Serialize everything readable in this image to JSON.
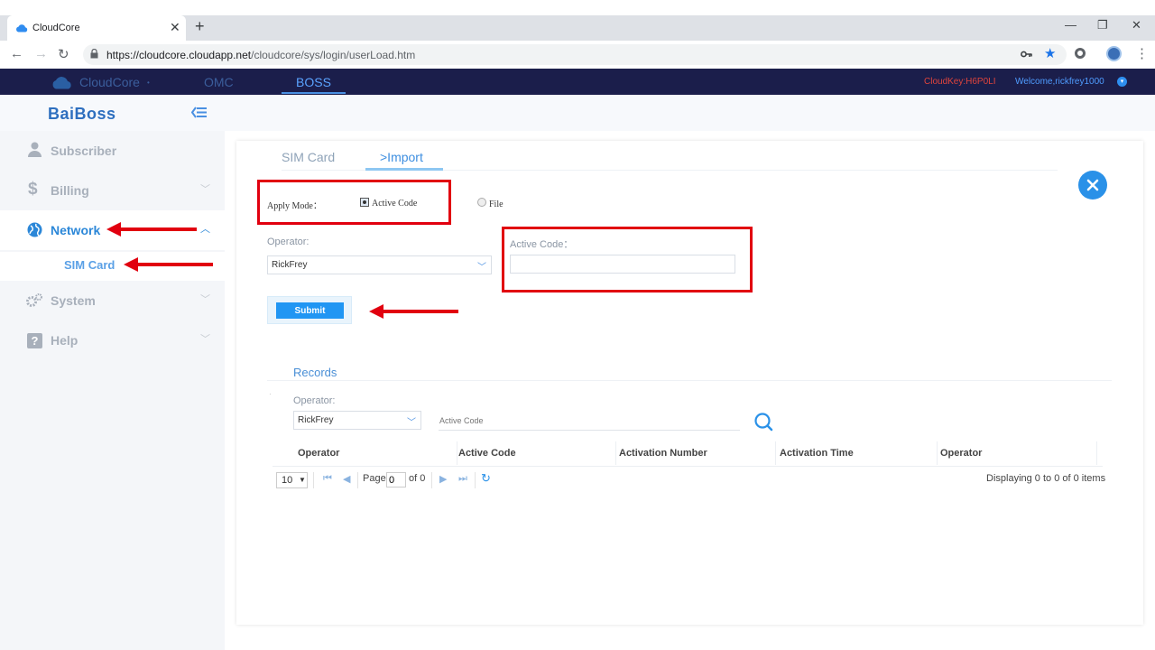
{
  "browser": {
    "tab_title": "CloudCore",
    "tab_close": "✕",
    "new_tab": "+",
    "minimize": "—",
    "maximize": "❐",
    "close_window": "✕",
    "url_host": "https://cloudcore.cloudapp.net",
    "url_path": "/cloudcore/sys/login/userLoad.htm"
  },
  "topnav": {
    "brand": "CloudCore",
    "items": [
      "OMC",
      "BOSS"
    ],
    "active_item": "BOSS",
    "cloud_key": "CloudKey:H6P0LI",
    "welcome": "Welcome,rickfrey1000"
  },
  "header": {
    "logo": "BaiBoss"
  },
  "sidebar": {
    "items": [
      {
        "label": "Subscriber",
        "icon": "user-icon",
        "chevron": ""
      },
      {
        "label": "Billing",
        "icon": "dollar-icon",
        "chevron": "﹀"
      },
      {
        "label": "Network",
        "icon": "globe-icon",
        "chevron": "︿"
      },
      {
        "label": "System",
        "icon": "gears-icon",
        "chevron": "﹀"
      },
      {
        "label": "Help",
        "icon": "help-icon",
        "chevron": "﹀"
      }
    ],
    "sub_item": "SIM Card"
  },
  "main": {
    "tabs": [
      "SIM Card",
      ">Import"
    ],
    "apply_mode_label": "Apply Mode：",
    "mode_options": [
      "Active Code",
      "File"
    ],
    "selected_mode": "Active Code",
    "operator_label": "Operator:",
    "operator_value": "RickFrey",
    "active_code_label": "Active Code：",
    "active_code_value": "",
    "submit_label": "Submit"
  },
  "records": {
    "title": "Records",
    "operator_label": "Operator:",
    "operator_value": "RickFrey",
    "active_code_placeholder": "Active Code",
    "columns": [
      "Operator",
      "Active Code",
      "Activation Number",
      "Activation Time",
      "Operator"
    ],
    "rows": [],
    "page_size": "10",
    "page_label": "Page",
    "page_value": "0",
    "of_label": "of 0",
    "display_text": "Displaying 0 to 0 of 0 items"
  },
  "colors": {
    "topnav_bg": "#1b1e4b",
    "accent": "#2196f3",
    "annotation_red": "#e1000f",
    "cloud_key": "#e0443c"
  }
}
